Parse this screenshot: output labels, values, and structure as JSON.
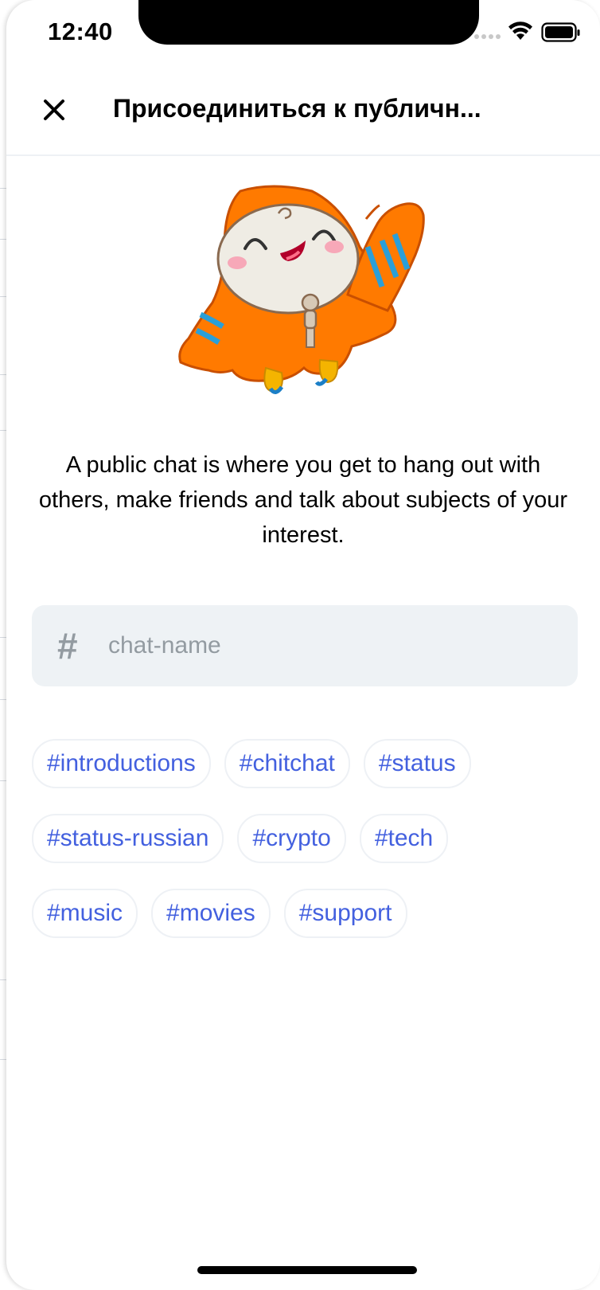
{
  "status_bar": {
    "time": "12:40"
  },
  "header": {
    "title": "Присоединиться к публичн..."
  },
  "description": "A public chat is where you get to hang out with others, make friends and talk about subjects of your interest.",
  "input": {
    "prefix": "#",
    "placeholder": "chat-name",
    "value": ""
  },
  "chips": [
    [
      "#introductions",
      "#chitchat",
      "#status"
    ],
    [
      "#status-russian",
      "#crypto",
      "#tech"
    ],
    [
      "#music",
      "#movies",
      "#support"
    ]
  ],
  "colors": {
    "accent": "#4360df",
    "input_bg": "#eef2f5",
    "placeholder": "#939ba1",
    "mascot_orange": "#ff7a00",
    "mascot_stripe": "#2a9fd8"
  },
  "icons": {
    "close": "close-icon",
    "wifi": "wifi-icon",
    "battery": "battery-icon",
    "signal": "signal-icon"
  }
}
